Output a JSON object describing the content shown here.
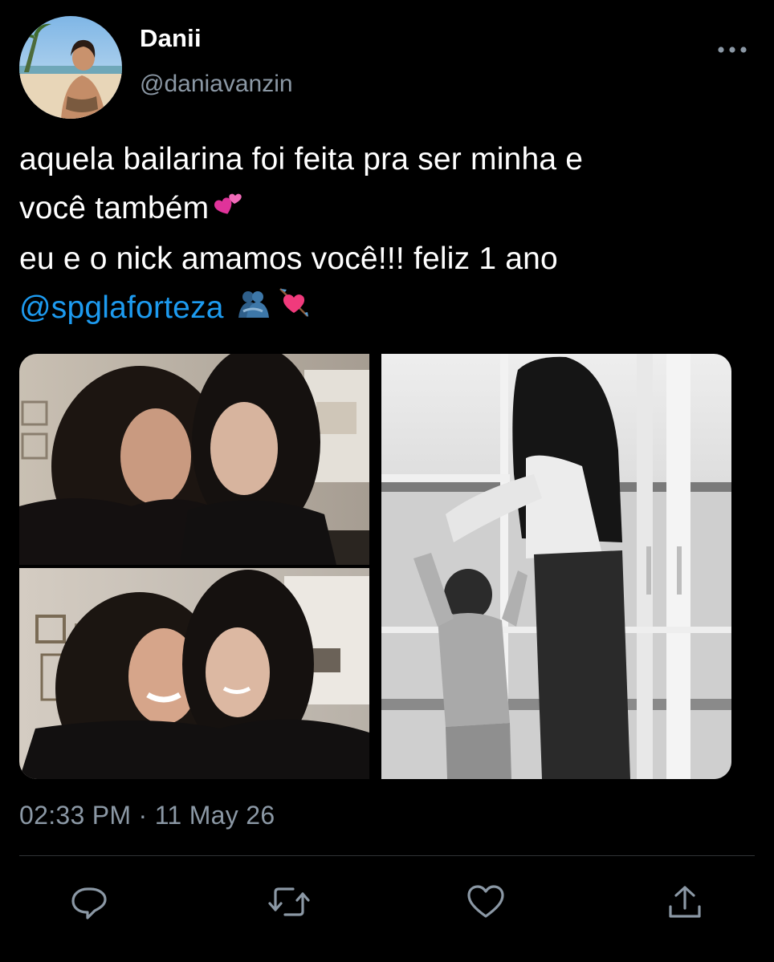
{
  "tweet": {
    "author": {
      "display_name": "Danii",
      "handle": "@daniavanzin"
    },
    "text": {
      "line1": "aquela bailarina foi feita pra ser minha e",
      "line2": "você também",
      "line3": "eu e o nick amamos você!!! feliz 1 ano",
      "mention": "@spglaforteza"
    },
    "emojis": [
      "two-hearts-emoji",
      "people-hugging-emoji",
      "heart-with-arrow-emoji"
    ],
    "timestamp": "02:33 PM · 11 May 26",
    "actions": [
      "reply-icon",
      "retweet-icon",
      "like-icon",
      "share-icon"
    ]
  },
  "colors": {
    "background": "#000000",
    "text": "#ffffff",
    "secondary": "#8b98a5",
    "accent": "#1d9bf0",
    "divider": "#2f3336"
  }
}
